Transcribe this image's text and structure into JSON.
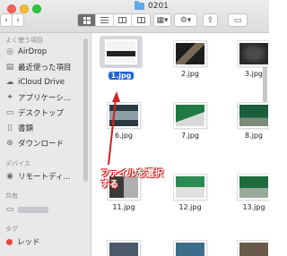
{
  "window": {
    "title": "0201"
  },
  "toolbar": {
    "back_label": "‹",
    "forward_label": "›",
    "views": [
      "icon",
      "list",
      "column",
      "gallery"
    ],
    "group_icon": "▦▾",
    "action_icon": "⚙▾",
    "share_icon": "⇪",
    "tag_icon": "▭"
  },
  "sidebar": {
    "favorites_header": "よく使う項目",
    "favorites": [
      {
        "icon": "airdrop-icon",
        "glyph": "◎",
        "label": "AirDrop"
      },
      {
        "icon": "recents-icon",
        "glyph": "▤",
        "label": "最近使った項目"
      },
      {
        "icon": "icloud-icon",
        "glyph": "☁",
        "label": "iCloud Drive"
      },
      {
        "icon": "applications-icon",
        "glyph": "✦",
        "label": "アプリケーシ..."
      },
      {
        "icon": "desktop-icon",
        "glyph": "▭",
        "label": "デスクトップ"
      },
      {
        "icon": "documents-icon",
        "glyph": "▯",
        "label": "書類"
      },
      {
        "icon": "downloads-icon",
        "glyph": "⊕",
        "label": "ダウンロード"
      }
    ],
    "devices_header": "デバイス",
    "devices": [
      {
        "icon": "remote-disc-icon",
        "glyph": "◉",
        "label": "リモートディ..."
      }
    ],
    "shared_header": "共有",
    "tags_header": "タグ",
    "tags": [
      {
        "label": "レッド",
        "color": "#e8433c"
      }
    ]
  },
  "files": [
    {
      "name": "1.jpg",
      "selected": true,
      "colors": [
        "#f4f4f4",
        "#222222"
      ]
    },
    {
      "name": "2.jpg",
      "selected": false,
      "colors": [
        "#1d1d1d",
        "#7a6a55"
      ]
    },
    {
      "name": "3.jpg",
      "selected": false,
      "colors": [
        "#2a2a2a",
        "#4a4a4a"
      ]
    },
    {
      "name": "6.jpg",
      "selected": false,
      "colors": [
        "#2c3a42",
        "#8ca0a8"
      ]
    },
    {
      "name": "7.jpg",
      "selected": false,
      "colors": [
        "#1f7a44",
        "#d8d8d8"
      ]
    },
    {
      "name": "8.jpg",
      "selected": false,
      "colors": [
        "#1b5e3a",
        "#7b8c7b"
      ]
    },
    {
      "name": "11.jpg",
      "selected": false,
      "colors": [
        "#3a3a3a",
        "#b0b0b0"
      ]
    },
    {
      "name": "12.jpg",
      "selected": false,
      "colors": [
        "#2d8a52",
        "#e0e0e0"
      ]
    },
    {
      "name": "13.jpg",
      "selected": false,
      "colors": [
        "#1e6b3e",
        "#9aa99a"
      ]
    }
  ],
  "annotation": {
    "text": "ファイルを選択する",
    "color": "#d12020"
  }
}
